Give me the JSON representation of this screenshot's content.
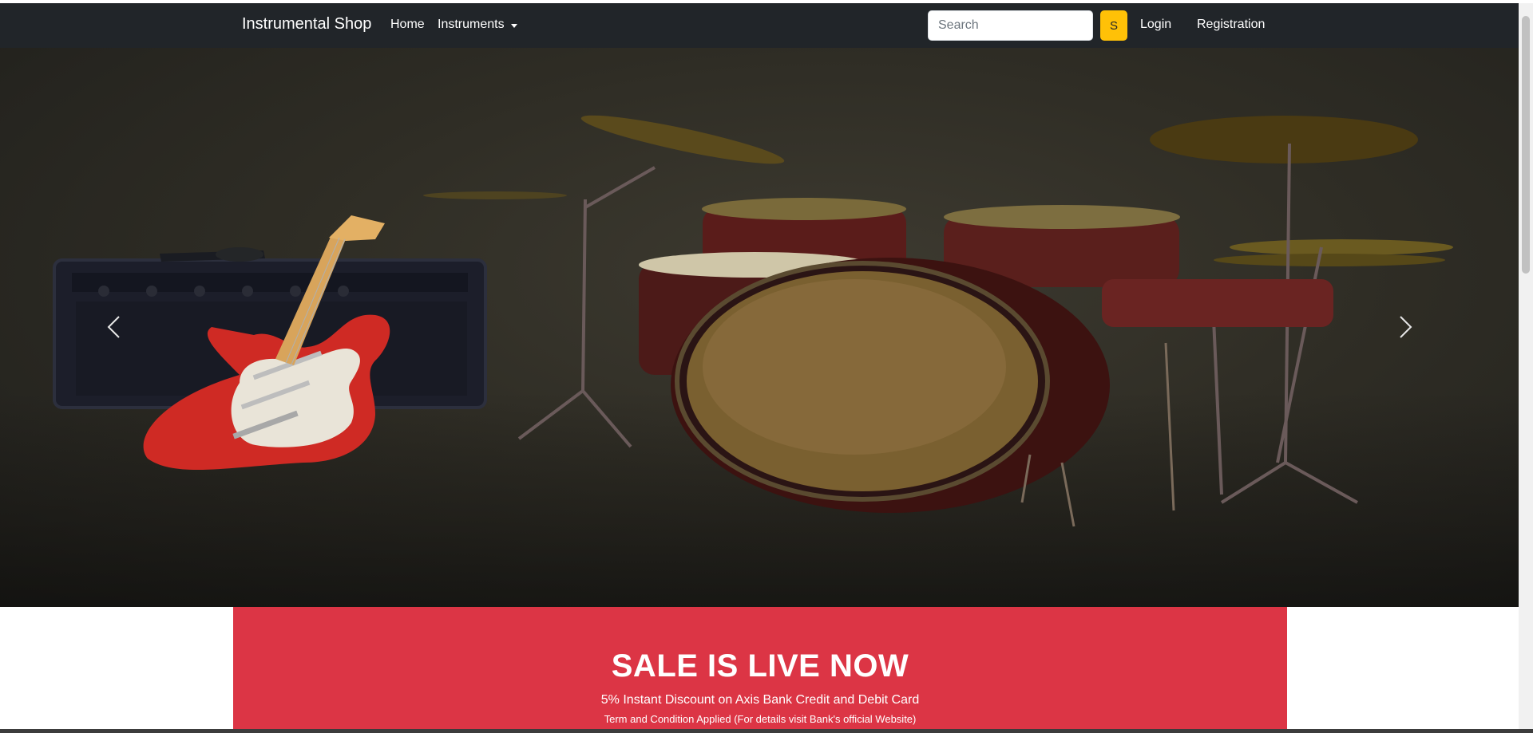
{
  "navbar": {
    "brand": "Instrumental Shop",
    "home": "Home",
    "instruments": "Instruments",
    "search_placeholder": "Search",
    "search_button": "S",
    "login": "Login",
    "registration": "Registration"
  },
  "carousel": {
    "prev_icon": "chevron-left-icon",
    "next_icon": "chevron-right-icon"
  },
  "sale": {
    "title": "SALE IS LIVE NOW",
    "line": "5% Instant Discount on Axis Bank Credit and Debit Card",
    "note": "Term and Condition Applied (For details visit Bank's official Website)"
  },
  "colors": {
    "navbar_bg": "#212529",
    "search_button": "#ffc107",
    "sale_bg": "#dc3545"
  }
}
